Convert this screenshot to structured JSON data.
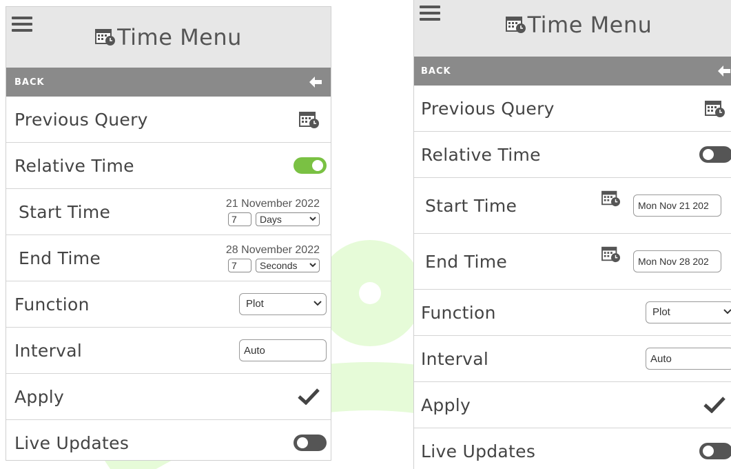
{
  "colors": {
    "toggle_on": "#7ac143",
    "toggle_off": "#555555",
    "header_bg": "#e7e7e7",
    "backbar_bg": "#8a8a8a"
  },
  "panel_a": {
    "header": {
      "menu_icon": "hamburger-icon",
      "title": "Time Menu",
      "title_icon": "calendar-clock-icon"
    },
    "back": {
      "label": "BACK",
      "icon": "arrow-left-icon"
    },
    "previous_query": {
      "label": "Previous Query",
      "icon": "calendar-clock-icon"
    },
    "relative_time": {
      "label": "Relative Time",
      "state": "on"
    },
    "start_time": {
      "label": "Start Time",
      "date": "21 November 2022",
      "amount": "7",
      "unit": "Days"
    },
    "end_time": {
      "label": "End Time",
      "date": "28 November 2022",
      "amount": "7",
      "unit": "Seconds"
    },
    "function": {
      "label": "Function",
      "value": "Plot"
    },
    "interval": {
      "label": "Interval",
      "value": "Auto"
    },
    "apply": {
      "label": "Apply",
      "icon": "checkmark-icon"
    },
    "live_updates": {
      "label": "Live Updates",
      "state": "off"
    }
  },
  "panel_b": {
    "header": {
      "menu_icon": "hamburger-icon",
      "title": "Time Menu",
      "title_icon": "calendar-clock-icon"
    },
    "back": {
      "label": "BACK",
      "icon": "arrow-left-icon"
    },
    "previous_query": {
      "label": "Previous Query",
      "icon": "calendar-clock-icon"
    },
    "relative_time": {
      "label": "Relative Time",
      "state": "off"
    },
    "start_time": {
      "label": "Start Time",
      "value": "Mon Nov 21 202",
      "icon": "calendar-clock-icon"
    },
    "end_time": {
      "label": "End Time",
      "value": "Mon Nov 28 202",
      "icon": "calendar-clock-icon"
    },
    "function": {
      "label": "Function",
      "value": "Plot"
    },
    "interval": {
      "label": "Interval",
      "value": "Auto"
    },
    "apply": {
      "label": "Apply",
      "icon": "checkmark-icon"
    },
    "live_updates": {
      "label": "Live Updates",
      "state": "off"
    }
  }
}
